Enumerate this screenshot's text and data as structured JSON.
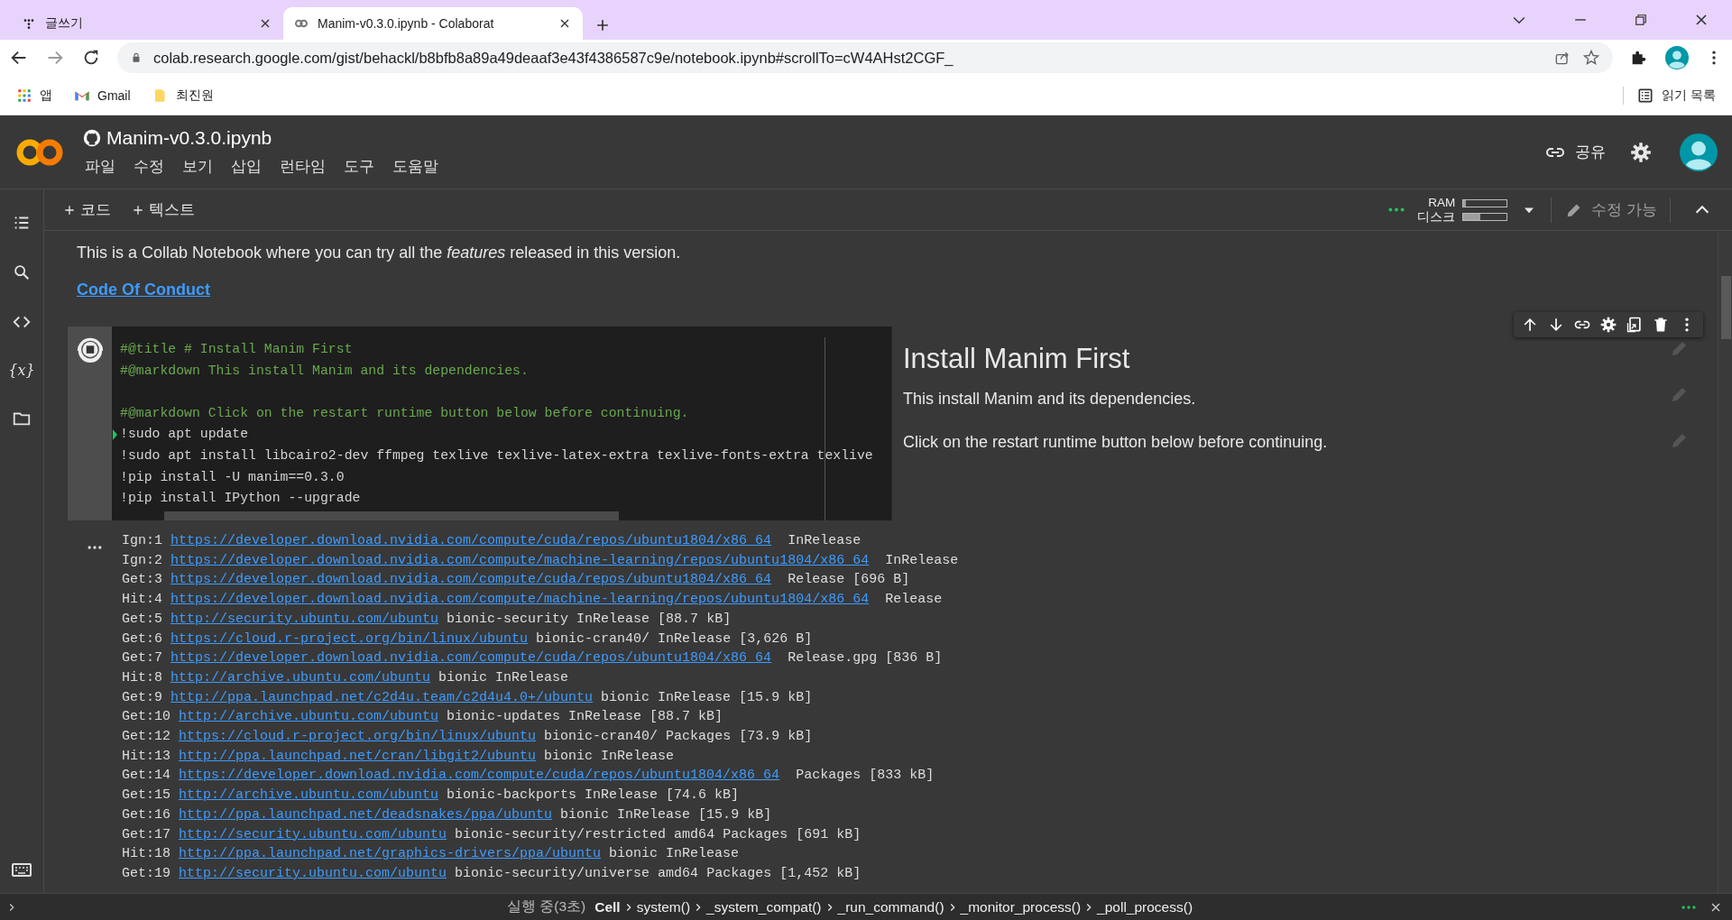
{
  "browser": {
    "tabs": [
      {
        "title": "글쓰기",
        "kind": "dots",
        "selected": false
      },
      {
        "title": "Manim-v0.3.0.ipynb - Colaborat",
        "kind": "colab",
        "selected": true
      }
    ],
    "url": "colab.research.google.com/gist/behackl/b8bfb8a89a49deaaf3e43f4386587c9e/notebook.ipynb#scrollTo=cW4AHst2CGF_",
    "bookmarks": [
      {
        "label": "앱",
        "kind": "apps"
      },
      {
        "label": "Gmail",
        "kind": "gmail"
      },
      {
        "label": "최진원",
        "kind": "folder"
      }
    ],
    "reading_list": "읽기 목록"
  },
  "colab": {
    "title": "Manim-v0.3.0.ipynb",
    "menu": [
      "파일",
      "수정",
      "보기",
      "삽입",
      "런타임",
      "도구",
      "도움말"
    ],
    "share": "공유"
  },
  "toolbar": {
    "add": [
      "코드",
      "텍스트"
    ],
    "ram": {
      "label": "RAM",
      "level": 0.05
    },
    "disk": {
      "label": "디스크",
      "level": 0.4
    },
    "edit_mode": "수정 가능"
  },
  "sidebar": {
    "variables": "{x}"
  },
  "intro": {
    "text": "This is a Collab Notebook where you can try all the *features* released in this version.",
    "link": "Code Of Conduct"
  },
  "cell": {
    "running": true,
    "code": [
      {
        "kind": "comment",
        "text": "#@title # Install Manim First",
        "cursor": false
      },
      {
        "kind": "comment",
        "text": "#@markdown This install Manim and its dependencies.",
        "cursor": false
      },
      {
        "kind": "blank"
      },
      {
        "kind": "comment",
        "text": "#@markdown Click on the restart runtime button below before continuing.",
        "cursor": false
      },
      {
        "kind": "command",
        "text": "!sudo apt update",
        "cursor": true
      },
      {
        "kind": "command",
        "text": "!sudo apt install libcairo2-dev ffmpeg texlive texlive-latex-extra texlive-fonts-extra texlive",
        "cursor": false
      },
      {
        "kind": "command",
        "text": "!pip install -U manim==0.3.0",
        "cursor": false
      },
      {
        "kind": "command",
        "text": "!pip install IPython --upgrade",
        "cursor": false
      }
    ],
    "form": {
      "title": "Install Manim First",
      "paragraphs": [
        "This install Manim and its dependencies.",
        "Click on the restart runtime button below before continuing."
      ]
    }
  },
  "output": [
    {
      "prefix": "Ign:1",
      "url": "https://developer.download.nvidia.com/compute/cuda/repos/ubuntu1804/x86_64",
      "suffix": " InRelease"
    },
    {
      "prefix": "Ign:2",
      "url": "https://developer.download.nvidia.com/compute/machine-learning/repos/ubuntu1804/x86_64",
      "suffix": " InRelease"
    },
    {
      "prefix": "Get:3",
      "url": "https://developer.download.nvidia.com/compute/cuda/repos/ubuntu1804/x86_64",
      "suffix": " Release [696 B]"
    },
    {
      "prefix": "Hit:4",
      "url": "https://developer.download.nvidia.com/compute/machine-learning/repos/ubuntu1804/x86_64",
      "suffix": " Release"
    },
    {
      "prefix": "Get:5",
      "url": "http://security.ubuntu.com/ubuntu",
      "suffix": "bionic-security InRelease [88.7 kB]"
    },
    {
      "prefix": "Get:6",
      "url": "https://cloud.r-project.org/bin/linux/ubuntu",
      "suffix": "bionic-cran40/ InRelease [3,626 B]"
    },
    {
      "prefix": "Get:7",
      "url": "https://developer.download.nvidia.com/compute/cuda/repos/ubuntu1804/x86_64",
      "suffix": " Release.gpg [836 B]"
    },
    {
      "prefix": "Hit:8",
      "url": "http://archive.ubuntu.com/ubuntu",
      "suffix": "bionic InRelease"
    },
    {
      "prefix": "Get:9",
      "url": "http://ppa.launchpad.net/c2d4u.team/c2d4u4.0+/ubuntu",
      "suffix": "bionic InRelease [15.9 kB]"
    },
    {
      "prefix": "Get:10",
      "url": "http://archive.ubuntu.com/ubuntu",
      "suffix": "bionic-updates InRelease [88.7 kB]"
    },
    {
      "prefix": "Get:12",
      "url": "https://cloud.r-project.org/bin/linux/ubuntu",
      "suffix": "bionic-cran40/ Packages [73.9 kB]"
    },
    {
      "prefix": "Hit:13",
      "url": "http://ppa.launchpad.net/cran/libgit2/ubuntu",
      "suffix": "bionic InRelease"
    },
    {
      "prefix": "Get:14",
      "url": "https://developer.download.nvidia.com/compute/cuda/repos/ubuntu1804/x86_64",
      "suffix": " Packages [833 kB]"
    },
    {
      "prefix": "Get:15",
      "url": "http://archive.ubuntu.com/ubuntu",
      "suffix": "bionic-backports InRelease [74.6 kB]"
    },
    {
      "prefix": "Get:16",
      "url": "http://ppa.launchpad.net/deadsnakes/ppa/ubuntu",
      "suffix": "bionic InRelease [15.9 kB]"
    },
    {
      "prefix": "Get:17",
      "url": "http://security.ubuntu.com/ubuntu",
      "suffix": "bionic-security/restricted amd64 Packages [691 kB]"
    },
    {
      "prefix": "Hit:18",
      "url": "http://ppa.launchpad.net/graphics-drivers/ppa/ubuntu",
      "suffix": "bionic InRelease"
    },
    {
      "prefix": "Get:19",
      "url": "http://security.ubuntu.com/ubuntu",
      "suffix": "bionic-security/universe amd64 Packages [1,452 kB]"
    }
  ],
  "status": {
    "state": "실행 중(3초)",
    "trace": [
      "Cell",
      "system()",
      "_system_compat()",
      "_run_command()",
      "_monitor_process()",
      "_poll_process()"
    ]
  }
}
